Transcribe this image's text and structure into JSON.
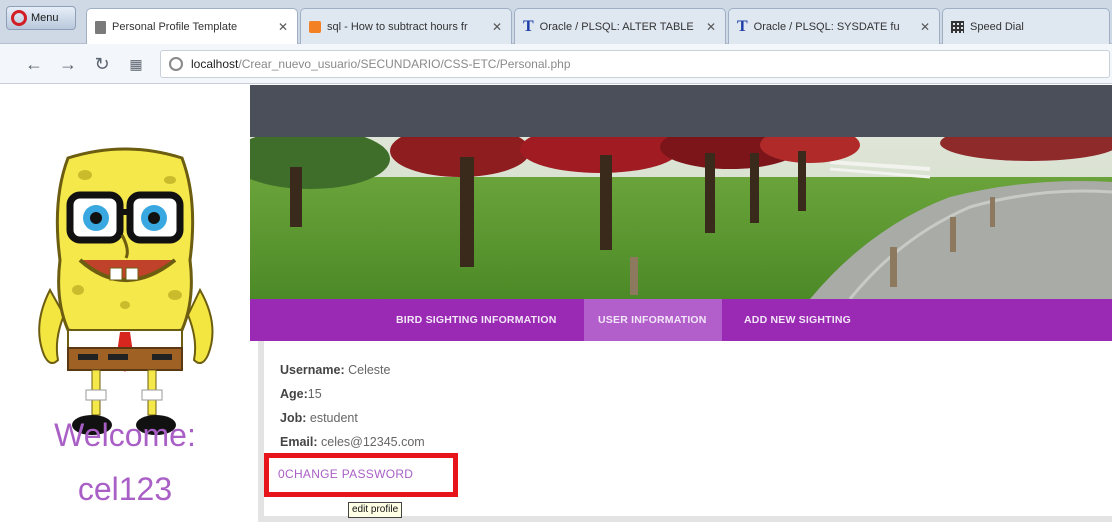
{
  "browser": {
    "menu_label": "Menu",
    "tabs": [
      {
        "title": "Personal Profile Template",
        "active": true
      },
      {
        "title": "sql - How to subtract hours fr",
        "active": false
      },
      {
        "title": "Oracle / PLSQL: ALTER TABLE",
        "active": false
      },
      {
        "title": "Oracle / PLSQL: SYSDATE fu",
        "active": false
      },
      {
        "title": "Speed Dial",
        "active": false
      }
    ],
    "url_host": "localhost",
    "url_path": "/Crear_nuevo_usuario/SECUNDARIO/CSS-ETC/Personal.php"
  },
  "sidebar": {
    "welcome": "Welcome:",
    "username": "cel123"
  },
  "menu": {
    "items": [
      "BIRD SIGHTING INFORMATION",
      "USER INFORMATION",
      "ADD NEW SIGHTING"
    ],
    "active_index": 1
  },
  "profile": {
    "username_label": "Username:",
    "username_value": " Celeste",
    "age_label": "Age:",
    "age_value": "15",
    "job_label": "Job:",
    "job_value": " estudent",
    "email_label": "Email:",
    "email_value": " celes@12345.com",
    "change_password": "0CHANGE PASSWORD",
    "tooltip": "edit profile"
  },
  "colors": {
    "accent": "#9a29b4",
    "accent_active": "#b25fcc",
    "welcome_text": "#a95fc6",
    "highlight_box": "#e8141b",
    "topbar": "#4b4f5a"
  }
}
